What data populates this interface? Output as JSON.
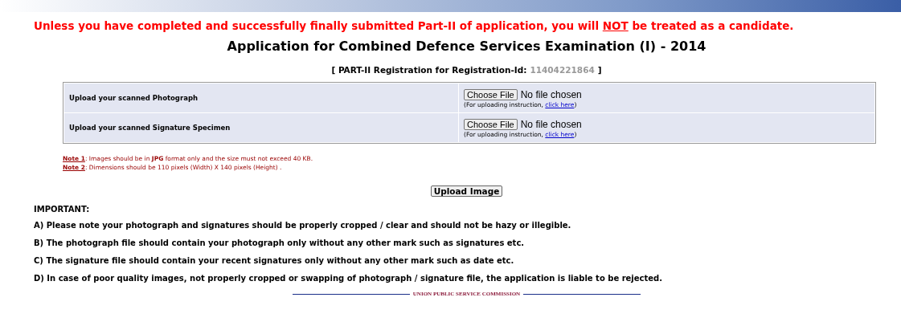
{
  "warning": {
    "before": "Unless you have completed and successfully finally submitted Part-II of application, you will ",
    "emphasis": "NOT",
    "after": " be treated as a candidate."
  },
  "title": "Application for Combined Defence Services Examination (I) - 2014",
  "registration": {
    "open": "[",
    "label": "PART-II Registration for Registration-Id:",
    "id": "11404221864",
    "close": "]"
  },
  "uploads": [
    {
      "label": "Upload your scanned Photograph",
      "button": "Choose File",
      "status": "No file chosen",
      "hint_before": "(For uploading instruction, ",
      "link": "click here",
      "hint_after": ")"
    },
    {
      "label": "Upload your scanned Signature Specimen",
      "button": "Choose File",
      "status": "No file chosen",
      "hint_before": "(For uploading instruction, ",
      "link": "click here",
      "hint_after": ")"
    }
  ],
  "notes": [
    {
      "label": "Note 1",
      "text": ": Images should be in **JPG** format only and the size must not exceed 40 KB."
    },
    {
      "label": "Note 2",
      "text": ": Dimensions should be 110 pixels (Width) X 140 pixels (Height) ."
    }
  ],
  "submit_button": "Upload Image",
  "important": {
    "heading": "IMPORTANT:",
    "items": [
      "A) Please note your photograph and signatures should be properly cropped / clear and should not be hazy or illegible.",
      "B) The photograph file should contain your photograph only without any other mark such as signatures etc.",
      "C) The signature file should contain your recent signatures only without any other mark such as date etc.",
      "D) In case of poor quality images, not properly cropped or swapping of photograph / signature file, the application is liable to be rejected."
    ]
  },
  "footer": "UNION PUBLIC SERVICE COMMISSION"
}
